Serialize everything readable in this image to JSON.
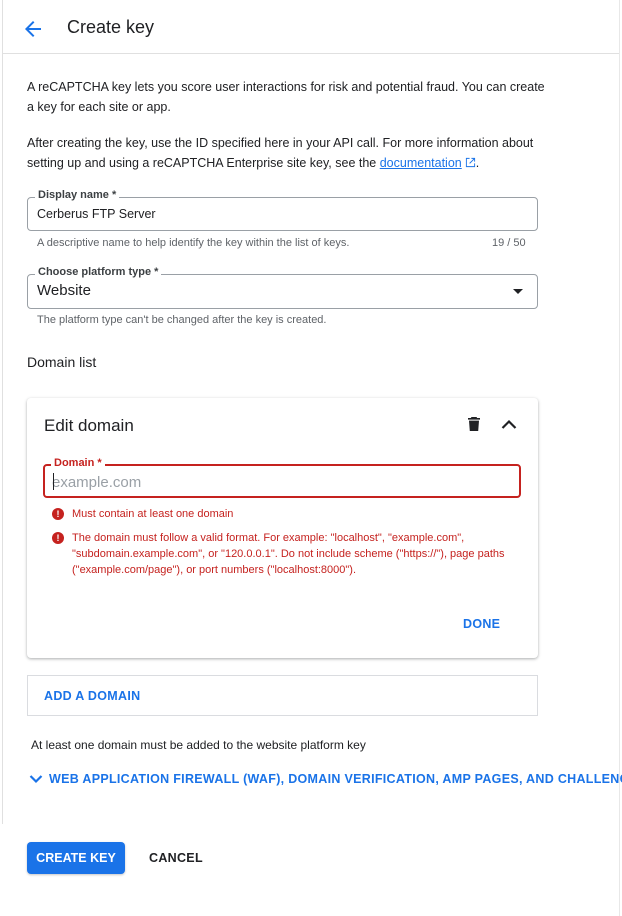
{
  "header": {
    "title": "Create key"
  },
  "intro": {
    "p1": "A reCAPTCHA key lets you score user interactions for risk and potential fraud. You can create a key for each site or app.",
    "p2_text": "After creating the key, use the ID specified here in your API call. For more information about setting up and using a reCAPTCHA Enterprise site key, see the ",
    "p2_link": "documentation",
    "p2_end": "."
  },
  "display_name": {
    "label": "Display name *",
    "value": "Cerberus FTP Server",
    "hint": "A descriptive name to help identify the key within the list of keys.",
    "counter": "19 / 50"
  },
  "platform": {
    "label": "Choose platform type *",
    "value": "Website",
    "hint": "The platform type can't be changed after the key is created."
  },
  "domain_list": {
    "title": "Domain list",
    "card_title": "Edit domain",
    "field_label": "Domain *",
    "placeholder": "example.com",
    "errors": [
      "Must contain at least one domain",
      "The domain must follow a valid format. For example: \"localhost\", \"example.com\", \"subdomain.example.com\", or \"120.0.0.1\". Do not include scheme (\"https://\"), page paths (\"example.com/page\"), or port numbers (\"localhost:8000\")."
    ],
    "done_label": "DONE",
    "add_label": "ADD A DOMAIN",
    "note": "At least one domain must be added to the website platform key"
  },
  "advanced": {
    "label": "WEB APPLICATION FIREWALL (WAF), DOMAIN VERIFICATION, AMP PAGES, AND CHALLENGE"
  },
  "actions": {
    "create_label": "CREATE KEY",
    "cancel_label": "CANCEL"
  },
  "colors": {
    "accent": "#1a73e8",
    "error": "#c5221f",
    "text": "#202124",
    "muted": "#5f6368",
    "border": "#9aa0a6"
  },
  "icons": {
    "back": "arrow-left-icon",
    "external": "external-link-icon",
    "dropdown": "caret-down-icon",
    "delete": "trash-icon",
    "collapse": "chevron-up-icon",
    "error": "error-circle-icon",
    "expand": "chevron-down-icon"
  }
}
